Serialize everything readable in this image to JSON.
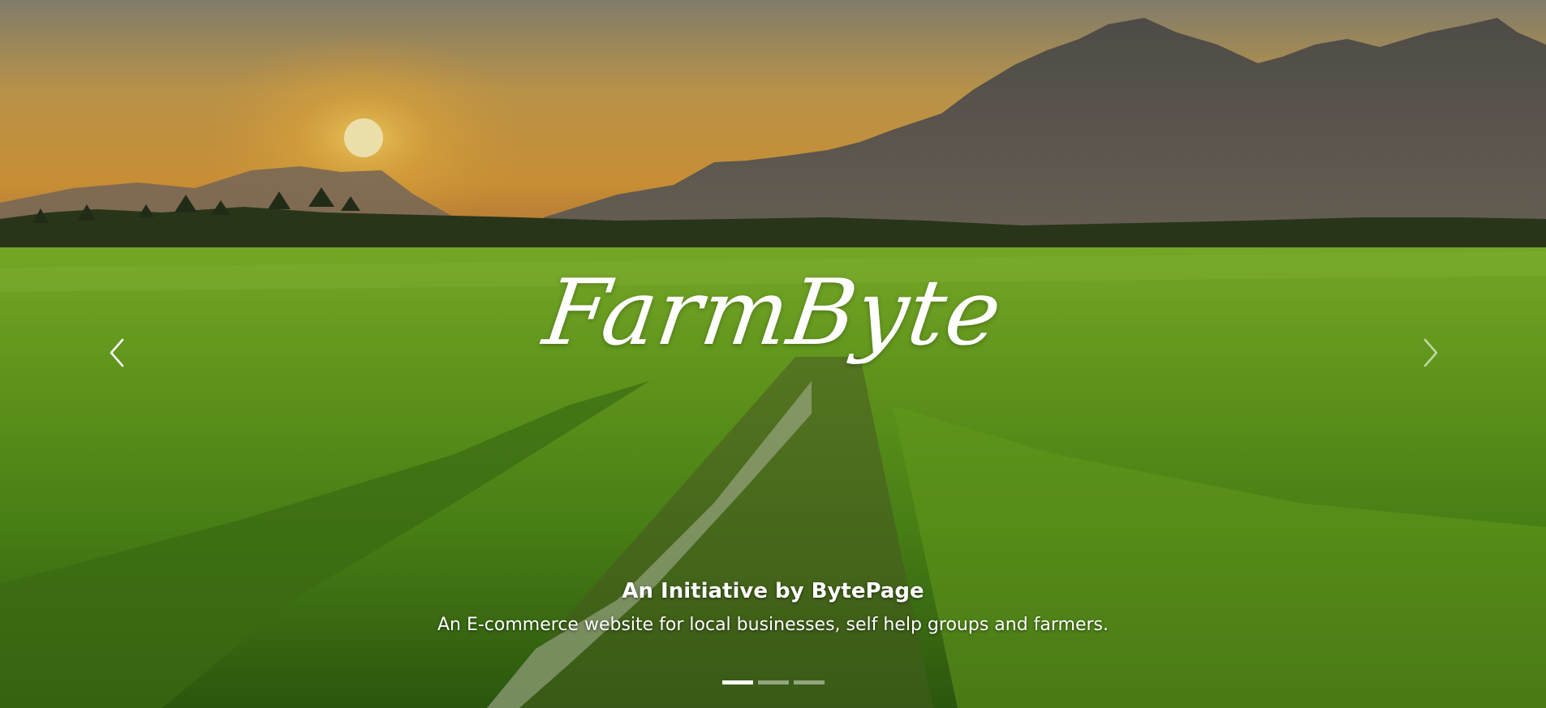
{
  "hero": {
    "brand": "FarmByte",
    "caption_title": "An Initiative by BytePage",
    "caption_text": "An E-commerce website for local businesses, self help groups and farmers."
  },
  "carousel": {
    "prev_icon": "chevron-left-icon",
    "next_icon": "chevron-right-icon",
    "slide_count": 3,
    "active_slide": 1
  },
  "colors": {
    "sky_top": "#8f8a74",
    "sun": "#ffe07a",
    "field": "#5e9a1c",
    "text": "#ffffff"
  }
}
